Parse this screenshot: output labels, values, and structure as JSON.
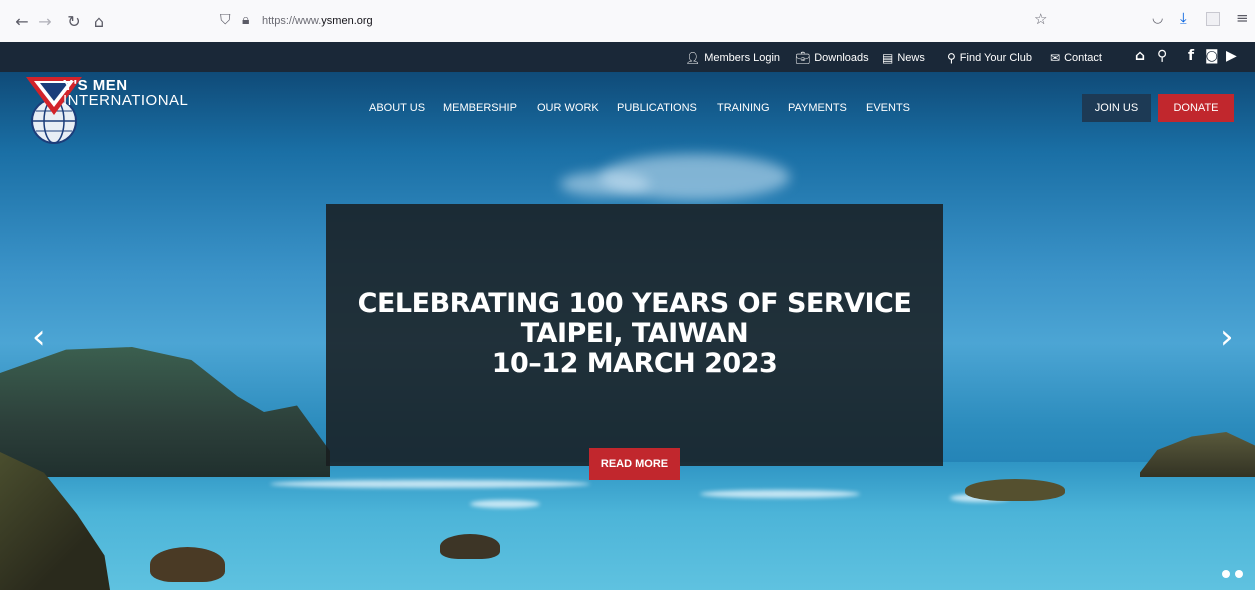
{
  "browser": {
    "url_prefix": "https://www.",
    "url_domain": "ysmen.org"
  },
  "topbar": {
    "members_login": "Members Login",
    "downloads": "Downloads",
    "news": "News",
    "find_your_club": "Find Your Club",
    "contact": "Contact"
  },
  "brand": {
    "line1": "Y'S MEN",
    "line2": "INTERNATIONAL"
  },
  "nav": {
    "items": [
      {
        "label": "ABOUT US"
      },
      {
        "label": "MEMBERSHIP"
      },
      {
        "label": "OUR WORK"
      },
      {
        "label": "PUBLICATIONS"
      },
      {
        "label": "TRAINING"
      },
      {
        "label": "PAYMENTS"
      },
      {
        "label": "EVENTS"
      }
    ],
    "join_label": "JOIN US",
    "donate_label": "DONATE"
  },
  "slide": {
    "line1": "CELEBRATING 100 YEARS OF SERVICE",
    "line2": "TAIPEI, TAIWAN",
    "line3": "10–12 MARCH 2023",
    "read_more": "READ MORE",
    "active_slide": 1,
    "slide_count": 2
  },
  "colors": {
    "accent_red": "#c1272d",
    "topbar_bg": "#1a2838",
    "join_bg": "#1d3a55"
  }
}
